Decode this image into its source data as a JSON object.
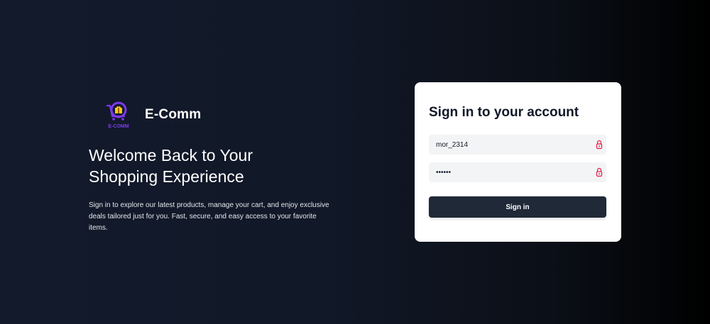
{
  "brand": {
    "name": "E-Comm",
    "logo_text": "E-COMM",
    "logo_icon": "shopping-cart-gift-icon",
    "logo_color": "#6d28d9",
    "logo_accent": "#facc15"
  },
  "hero": {
    "headline_line1": "Welcome Back to Your",
    "headline_line2": "Shopping Experience",
    "description": "Sign in to explore our latest products, manage your cart, and enjoy exclusive deals tailored just for you. Fast, secure, and easy access to your favorite items."
  },
  "login": {
    "title": "Sign in to your account",
    "username_value": "mor_2314",
    "password_value": "••••••",
    "field_icon": "lock-icon",
    "field_icon_color": "#e11d48",
    "submit_label": "Sign in"
  },
  "colors": {
    "background": "#111827",
    "card": "#ffffff",
    "button": "#1f2937",
    "input_bg": "#f3f4f6"
  }
}
